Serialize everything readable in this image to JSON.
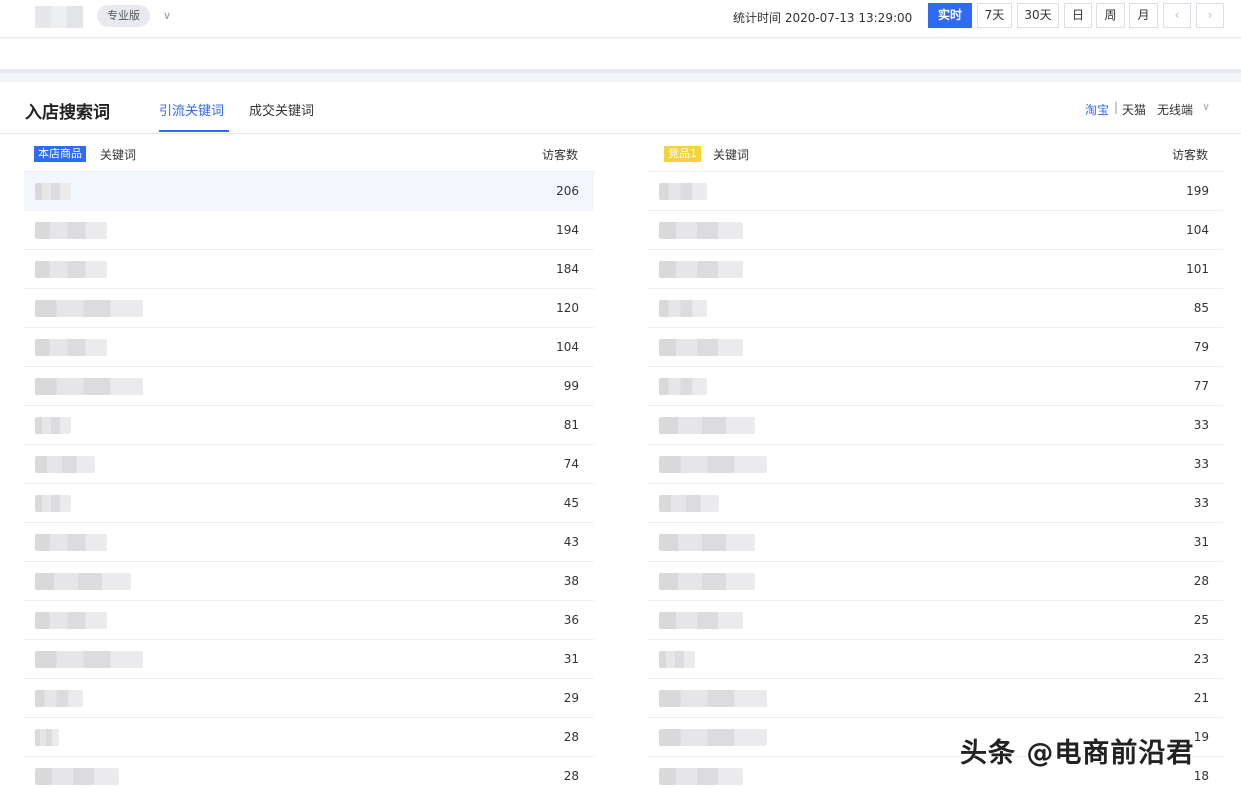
{
  "header": {
    "edition_badge": "专业版",
    "stat_time_label": "统计时间 2020-07-13 13:29:00",
    "ranges": [
      {
        "label": "实时",
        "active": true
      },
      {
        "label": "7天",
        "active": false
      },
      {
        "label": "30天",
        "active": false
      },
      {
        "label": "日",
        "active": false
      },
      {
        "label": "周",
        "active": false
      },
      {
        "label": "月",
        "active": false
      }
    ],
    "prev_icon": "chevron-left-icon",
    "next_icon": "chevron-right-icon"
  },
  "panel": {
    "title": "入店搜索词",
    "tabs": [
      {
        "label": "引流关键词",
        "active": true
      },
      {
        "label": "成交关键词",
        "active": false
      }
    ],
    "platforms": [
      {
        "label": "淘宝",
        "active": true
      },
      {
        "label": "天猫",
        "active": false
      }
    ],
    "separator": "|",
    "device_select": "无线端"
  },
  "left_table": {
    "tag": "本店商品",
    "keyword_header": "关键词",
    "visitors_header": "访客数",
    "rows": [
      206,
      194,
      184,
      120,
      104,
      99,
      81,
      74,
      45,
      43,
      38,
      36,
      31,
      29,
      28,
      28
    ]
  },
  "right_table": {
    "tag": "竞品1",
    "keyword_header": "关键词",
    "visitors_header": "访客数",
    "rows": [
      199,
      104,
      101,
      85,
      79,
      77,
      33,
      33,
      33,
      31,
      28,
      25,
      23,
      21,
      19,
      18
    ]
  },
  "watermark": "头条 @电商前沿君",
  "colors": {
    "accent": "#2f6bf0",
    "competitor_tag": "#f5d33d"
  }
}
